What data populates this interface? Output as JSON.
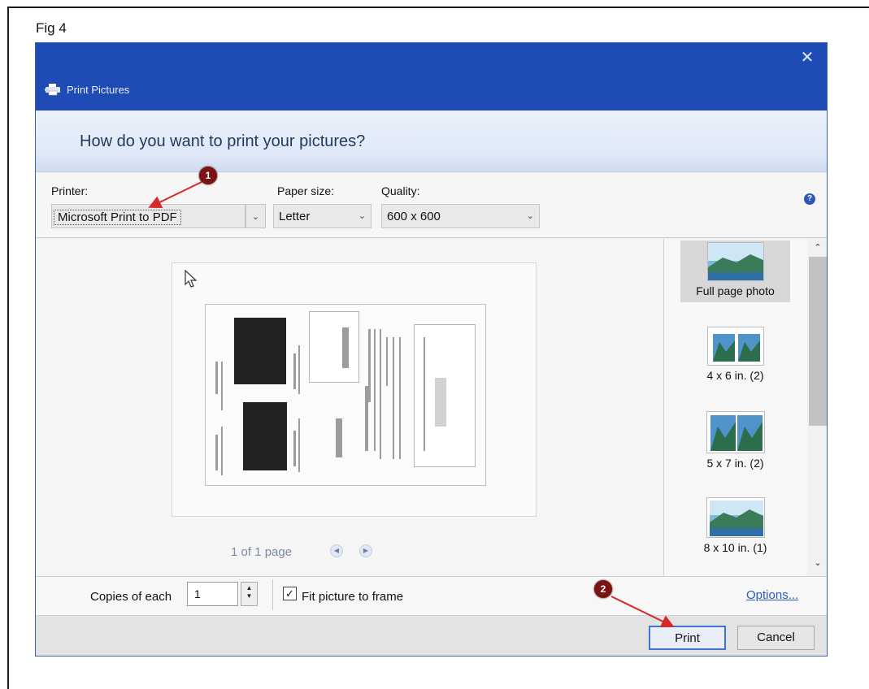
{
  "figure": {
    "label": "Fig 4"
  },
  "window": {
    "title": "Print Pictures",
    "close_glyph": "✕"
  },
  "header": {
    "question": "How do you want to print your pictures?"
  },
  "settings": {
    "printer_label": "Printer:",
    "printer_value": "Microsoft Print to PDF",
    "paper_size_label": "Paper size:",
    "paper_size_value": "Letter",
    "quality_label": "Quality:",
    "quality_value": "600 x 600",
    "help_glyph": "?"
  },
  "preview": {
    "pager_text": "1 of 1 page",
    "prev_glyph": "◀",
    "next_glyph": "▶"
  },
  "layouts": {
    "items": [
      {
        "label": "Full page photo",
        "selected": true
      },
      {
        "label": "4 x 6 in. (2)",
        "selected": false
      },
      {
        "label": "5 x 7 in. (2)",
        "selected": false
      },
      {
        "label": "8 x 10 in. (1)",
        "selected": false
      }
    ],
    "scroll_up_glyph": "⌃",
    "scroll_down_glyph": "⌄"
  },
  "copies": {
    "label": "Copies of each",
    "value": "1",
    "fit_checked": true,
    "fit_label": "Fit picture to frame",
    "check_glyph": "✓",
    "options_label": "Options..."
  },
  "footer": {
    "print_label": "Print",
    "cancel_label": "Cancel"
  },
  "annotations": [
    {
      "number": "1"
    },
    {
      "number": "2"
    }
  ],
  "colors": {
    "titlebar": "#1f4bb4",
    "marker": "#7a1414",
    "arrow": "#d62828",
    "link": "#2b59c3"
  },
  "icons": {
    "window": "printer-icon",
    "close": "close-icon",
    "help": "help-icon",
    "cursor": "mouse-pointer-icon"
  }
}
